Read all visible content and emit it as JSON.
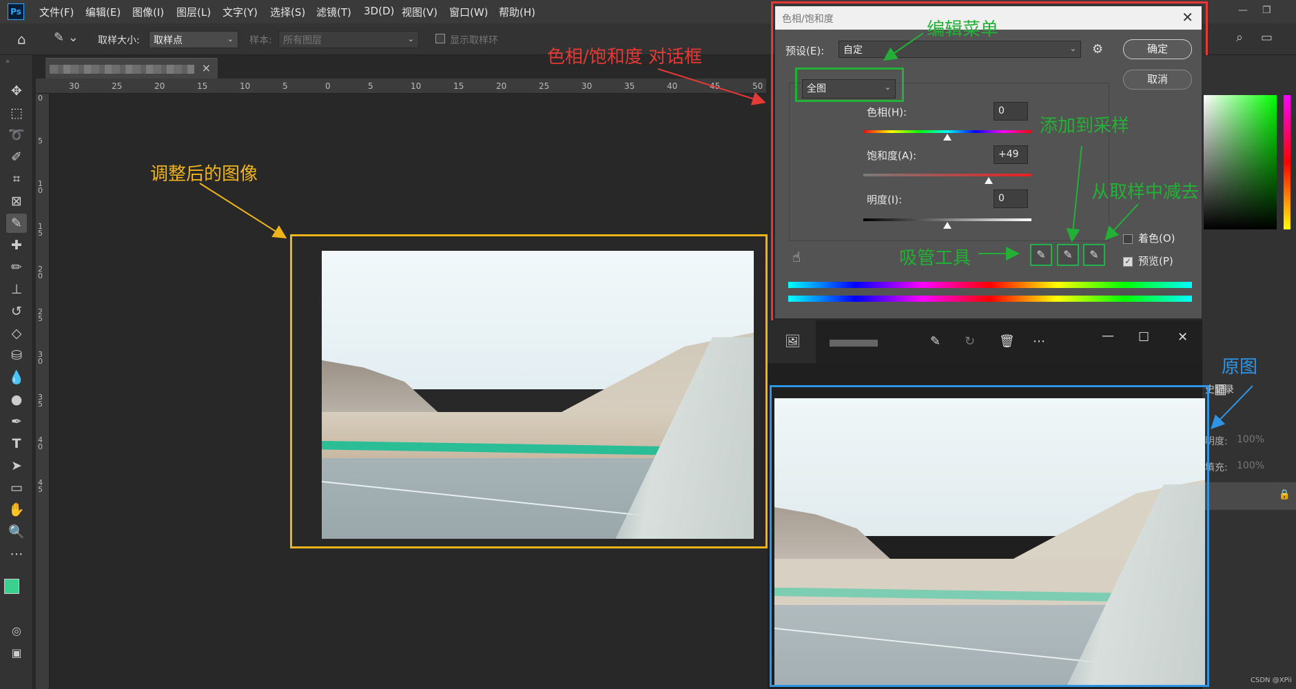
{
  "app": {
    "logo": "Ps"
  },
  "menu": [
    "文件(F)",
    "编辑(E)",
    "图像(I)",
    "图层(L)",
    "文字(Y)",
    "选择(S)",
    "滤镜(T)",
    "3D(D)",
    "视图(V)",
    "窗口(W)",
    "帮助(H)"
  ],
  "options": {
    "sample_size_label": "取样大小:",
    "sample_size_value": "取样点",
    "sample_label": "样本:",
    "sample_value": "所有图层",
    "show_ring_label": "显示取样环"
  },
  "rulers": {
    "top": [
      "30",
      "25",
      "20",
      "15",
      "10",
      "5",
      "0",
      "5",
      "10",
      "15",
      "20",
      "25",
      "30",
      "35",
      "40",
      "45",
      "50"
    ],
    "left": [
      "0",
      "5",
      "1 0",
      "1 5",
      "2 0",
      "2 5",
      "3 0",
      "3 5",
      "4 0",
      "4 5"
    ]
  },
  "dialog": {
    "title": "色相/饱和度",
    "preset_label": "预设(E):",
    "preset_value": "自定",
    "channel_value": "全图",
    "hue_label": "色相(H):",
    "hue_value": "0",
    "saturation_label": "饱和度(A):",
    "saturation_value": "+49",
    "lightness_label": "明度(I):",
    "lightness_value": "0",
    "ok_label": "确定",
    "cancel_label": "取消",
    "colorize_label": "着色(O)",
    "preview_label": "预览(P)",
    "colorize_checked": false,
    "preview_checked": true,
    "hue_level": 0.5,
    "saturation_level": 0.745,
    "lightness_level": 0.5
  },
  "right_panel": {
    "history_label": "史记录",
    "opacity_label": "明度:",
    "opacity_value": "100%",
    "fill_label": "填充:",
    "fill_value": "100%"
  },
  "annotations": {
    "dialog": "色相/饱和度 对话框",
    "edit_menu": "编辑菜单",
    "add_sample": "添加到采样",
    "subtract_sample": "从取样中减去",
    "eyedropper": "吸管工具",
    "adjusted": "调整后的图像",
    "original": "原图"
  },
  "watermark": "CSDN @XPii",
  "colors": {
    "red": "#e53935",
    "green": "#23b036",
    "orange": "#f0b41a",
    "blue": "#2e95e6"
  }
}
